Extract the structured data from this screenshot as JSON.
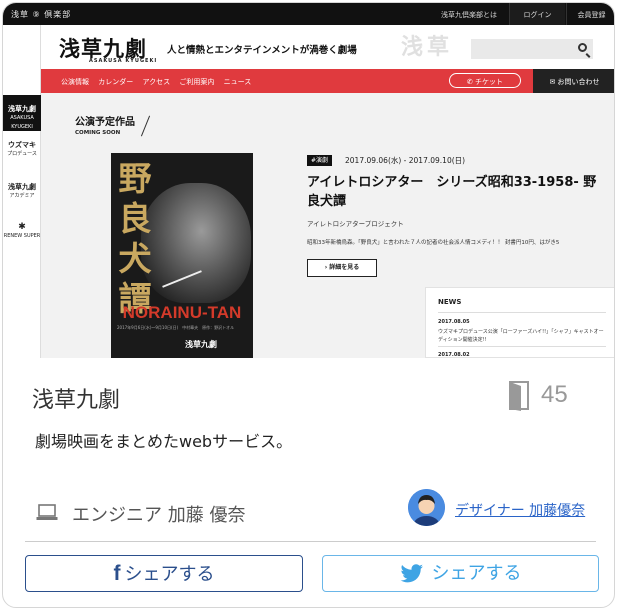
{
  "site": {
    "topbar": {
      "logo_text": "浅草 ⑨ 倶楽部",
      "about": "浅草九倶楽部とは",
      "login": "ログイン",
      "register": "会員登録"
    },
    "brand": "浅草九劇",
    "brand_sub": "ASAKUSA KYUGEKI",
    "tagline": "人と情熱とエンタテインメントが渦巻く劇場",
    "header_deco": "浅草",
    "nav": {
      "links": [
        "公演情報",
        "カレンダー",
        "アクセス",
        "ご利用案内",
        "ニュース"
      ],
      "ticket": "チケット",
      "contact": "お問い合わせ"
    },
    "rail": [
      {
        "label": "浅草九劇",
        "sub": "ASAKUSA KYUGEKI"
      },
      {
        "label": "ウズマキ",
        "sub": "プロデュース"
      },
      {
        "label": "浅草九劇",
        "sub": "アカデミア"
      },
      {
        "label": "",
        "sub": "RENEW SUPER"
      }
    ],
    "section": {
      "title": "公演予定作品",
      "sub": "COMING SOON"
    },
    "event": {
      "genre": "#演劇",
      "dates": "2017.09.06(水) - 2017.09.10(日)",
      "title": "アイレトロシアター　シリーズ昭和33-1958- 野良犬譚",
      "org": "アイレトロシアタープロジェクト",
      "desc": "昭和33年新橋烏森。「野良犬」と言われた７人の記者の社会派人情コメディ！！ 封書円10円、はがき5",
      "detail_button": "詳細を見る"
    },
    "poster": {
      "kanji": "野良犬譚",
      "english": "NORAINU-TAN",
      "text": "2017年9月6日(水)〜9月10日(日)　中村章夫　原作：野沢トオル",
      "brand": "浅草九劇"
    },
    "news": {
      "heading": "NEWS",
      "date1": "2017.08.05",
      "text1": "ウズマキプロデュース公演「ローファーズハイ!!」「シャフ」キャストオーディション開催決定!!",
      "date2": "2017.08.02"
    }
  },
  "card": {
    "title": "浅草九劇",
    "count": "45",
    "description": "劇場映画をまとめたwebサービス。",
    "engineer": "エンジニア 加藤 優奈",
    "designer": "デザイナー 加藤優奈",
    "share_facebook": "シェアする",
    "share_twitter": "シェアする"
  },
  "colors": {
    "nav_red": "#e03a3e",
    "facebook": "#2b4f8c",
    "twitter": "#3fa4e4",
    "designer_link": "#2a64c8"
  }
}
